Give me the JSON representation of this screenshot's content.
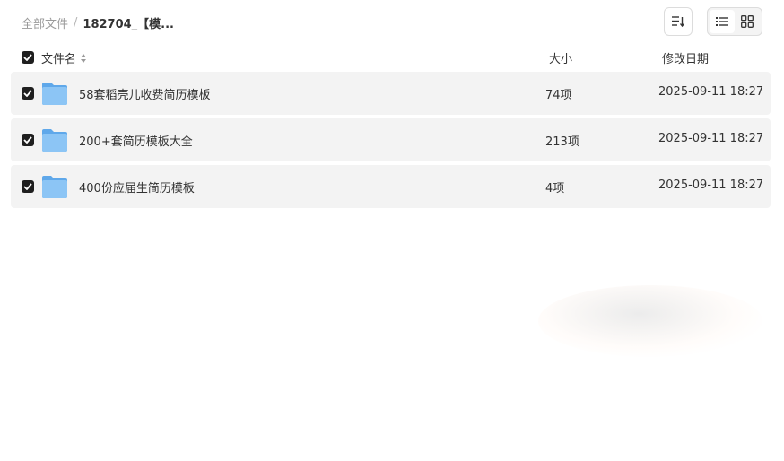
{
  "breadcrumb": {
    "root": "全部文件",
    "separator": "/",
    "current": "182704_【模..."
  },
  "toolbar": {
    "sort_icon": "sort-lines-icon",
    "list_view_icon": "list-view-icon",
    "grid_view_icon": "grid-view-icon",
    "active_view": "list"
  },
  "columns": {
    "name": "文件名",
    "size": "大小",
    "date": "修改日期"
  },
  "files": [
    {
      "name": "58套稻壳儿收费简历模板",
      "count": "74项",
      "date": "2025-09-11 18:27",
      "checked": true
    },
    {
      "name": "200+套简历模板大全",
      "count": "213项",
      "date": "2025-09-11 18:27",
      "checked": true
    },
    {
      "name": "400份应届生简历模板",
      "count": "4项",
      "date": "2025-09-11 18:27",
      "checked": true
    }
  ],
  "colors": {
    "folder": "#7db9ef",
    "checkbox": "#1f1f1f",
    "row_bg": "#f3f3f3"
  }
}
